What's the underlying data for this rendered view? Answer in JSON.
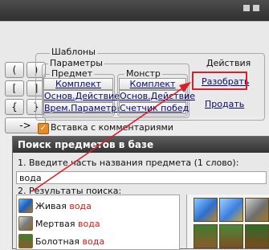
{
  "window": {
    "title": ""
  },
  "keypad": {
    "keys": [
      "(",
      ")",
      "[",
      "]",
      "{",
      "}",
      "->"
    ]
  },
  "templates": {
    "group_label": "Шаблоны",
    "params_label": "Параметры",
    "item_label": "Предмет",
    "item_buttons": [
      "Комплект",
      "Основ.Действие",
      "Врем.Параметры"
    ],
    "monster_label": "Монстр",
    "monster_buttons": [
      "Комплект",
      "Основ.Действие",
      "Счетчик побед"
    ],
    "actions_label": "Действия",
    "action_buttons": [
      "Разобрать",
      "Продать"
    ]
  },
  "checkbox": {
    "label": "Вставка с комментариями",
    "checked": true
  },
  "search_dialog": {
    "title": "Поиск предметов в базе",
    "step1_label": "1. Введите часть названия предмета (1 слово):",
    "query_value": "вода",
    "step2_label": "2. Результаты поиска:",
    "results": [
      {
        "prefix": "Живая ",
        "match": "вода"
      },
      {
        "prefix": "Мертвая ",
        "match": "вода"
      },
      {
        "prefix": "Болотная ",
        "match": "вода"
      }
    ]
  },
  "colors": {
    "highlight_box": "#d8222a",
    "match_text": "#d0201a",
    "checkbox": "#e88a25"
  }
}
